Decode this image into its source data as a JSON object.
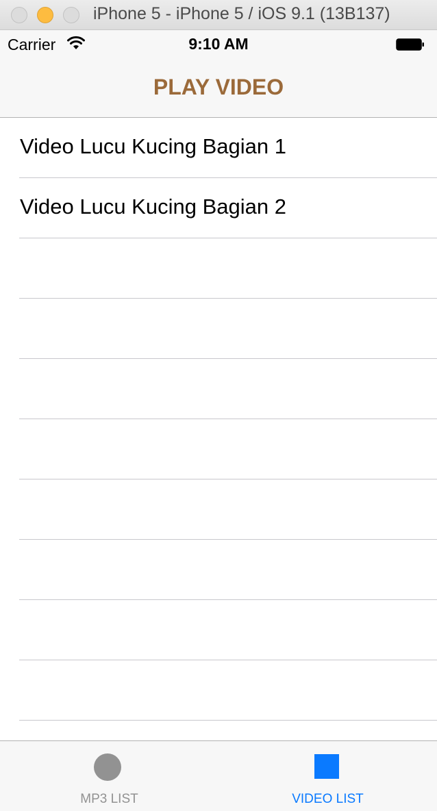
{
  "window": {
    "title": "iPhone 5 - iPhone 5 / iOS 9.1 (13B137)"
  },
  "status_bar": {
    "carrier": "Carrier",
    "time": "9:10 AM",
    "wifi_icon": "wifi-icon",
    "battery_icon": "battery-icon"
  },
  "nav": {
    "title": "PLAY VIDEO",
    "title_color": "#9b6a3a"
  },
  "table": {
    "rows": [
      {
        "label": "Video Lucu Kucing Bagian 1"
      },
      {
        "label": "Video Lucu Kucing Bagian 2"
      },
      {
        "label": ""
      },
      {
        "label": ""
      },
      {
        "label": ""
      },
      {
        "label": ""
      },
      {
        "label": ""
      },
      {
        "label": ""
      },
      {
        "label": ""
      },
      {
        "label": ""
      }
    ]
  },
  "tab_bar": {
    "tabs": [
      {
        "label": "MP3 LIST",
        "icon": "circle-icon",
        "selected": false,
        "color": "#929292"
      },
      {
        "label": "VIDEO LIST",
        "icon": "square-icon",
        "selected": true,
        "color": "#0a7aff"
      }
    ]
  }
}
